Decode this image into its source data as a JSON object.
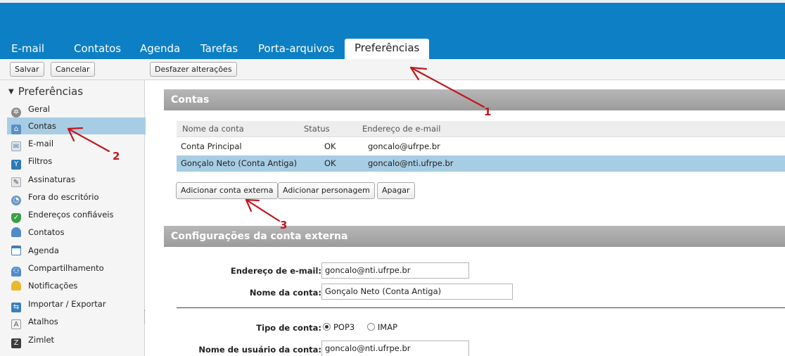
{
  "nav": {
    "tabs": [
      {
        "label": "E-mail"
      },
      {
        "label": "Contatos"
      },
      {
        "label": "Agenda"
      },
      {
        "label": "Tarefas"
      },
      {
        "label": "Porta-arquivos"
      },
      {
        "label": "Preferências"
      }
    ],
    "active_tab": "Preferências"
  },
  "toolbar": {
    "save_label": "Salvar",
    "cancel_label": "Cancelar",
    "undo_label": "Desfazer alterações"
  },
  "sidebar": {
    "root_label": "Preferências",
    "items": [
      {
        "label": "Geral",
        "icon": "gear-icon"
      },
      {
        "label": "Contas",
        "icon": "accounts-icon"
      },
      {
        "label": "E-mail",
        "icon": "envelope-icon"
      },
      {
        "label": "Filtros",
        "icon": "filter-icon"
      },
      {
        "label": "Assinaturas",
        "icon": "signature-icon"
      },
      {
        "label": "Fora do escritório",
        "icon": "out-of-office-icon"
      },
      {
        "label": "Endereços confiáveis",
        "icon": "shield-icon"
      },
      {
        "label": "Contatos",
        "icon": "contact-icon"
      },
      {
        "label": "Agenda",
        "icon": "calendar-icon"
      },
      {
        "label": "Compartilhamento",
        "icon": "sharing-icon"
      },
      {
        "label": "Notificações",
        "icon": "bell-icon"
      },
      {
        "label": "Importar / Exportar",
        "icon": "import-export-icon"
      },
      {
        "label": "Atalhos",
        "icon": "shortcut-icon"
      },
      {
        "label": "Zimlet",
        "icon": "zimlet-icon"
      }
    ],
    "selected": "Contas"
  },
  "accounts": {
    "header": "Contas",
    "columns": [
      "Nome da conta",
      "Status",
      "Endereço de e-mail"
    ],
    "rows": [
      {
        "name": "Conta Principal",
        "status": "OK",
        "email": "goncalo@ufrpe.br"
      },
      {
        "name": "Gonçalo Neto (Conta Antiga)",
        "status": "OK",
        "email": "goncalo@nti.ufrpe.br"
      }
    ],
    "selected_row": 1,
    "add_external_label": "Adicionar conta externa",
    "add_persona_label": "Adicionar personagem",
    "delete_label": "Apagar"
  },
  "external": {
    "header": "Configurações da conta externa",
    "email_label": "Endereço de e-mail:",
    "email_value": "goncalo@nti.ufrpe.br",
    "account_name_label": "Nome da conta:",
    "account_name_value": "Gonçalo Neto (Conta Antiga)",
    "account_type_label": "Tipo de conta:",
    "account_type_options": [
      "POP3",
      "IMAP"
    ],
    "account_type_selected": "POP3",
    "username_label": "Nome de usuário da conta:",
    "username_value": "goncalo@nti.ufrpe.br"
  },
  "annotations": {
    "marker_1": "1",
    "marker_2": "2",
    "marker_3": "3",
    "color": "#c0181f"
  },
  "colors": {
    "header_blue": "#0d7fc4",
    "selection": "#a7cde4",
    "section_header": "#a8a8a8"
  }
}
